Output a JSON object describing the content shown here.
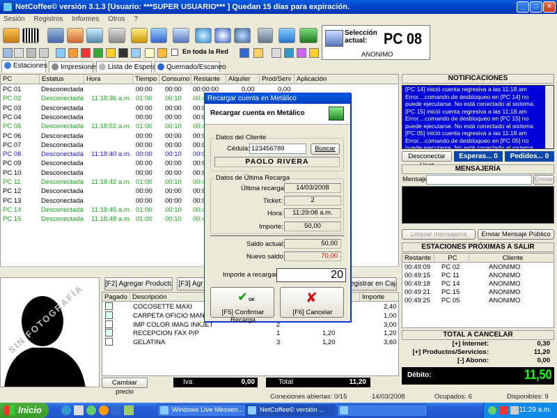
{
  "window": {
    "title": "NetCoffee© versión  3.1.3  [Usuario: ***SUPER USUARIO*** ]  Quedan 15 días para expiración."
  },
  "menu": [
    "Sesión",
    "Registros",
    "Informes",
    "Otros",
    "?"
  ],
  "toolbar": {
    "en_toda_la_red": "En toda la Red"
  },
  "selection": {
    "label_line1": "Selección",
    "label_line2": "actual:",
    "pc": "PC 08",
    "user": "ANONIMO"
  },
  "tabs": [
    "Estaciones",
    "Impresiones",
    "Lista de Espera",
    "Quemado/Escaneo"
  ],
  "stations": {
    "columns": [
      "PC",
      "Estatus",
      "Hora",
      "Tiempo",
      "Consumo",
      "Restante",
      "Alquiler",
      "Prod/Serv",
      "Aplicación"
    ],
    "rows": [
      {
        "pc": "PC 01",
        "status": "Desconectada",
        "hora": "",
        "tiempo": "00:00",
        "consumo": "00:00",
        "restante": "00:00:00",
        "alquiler": "0,00",
        "prod": "0,00",
        "color": "black"
      },
      {
        "pc": "PC 02",
        "status": "Desconectada",
        "hora": "11:18:36 a.m.",
        "tiempo": "01:00",
        "consumo": "00:10",
        "restante": "00:4",
        "alquiler": "",
        "prod": "",
        "color": "green"
      },
      {
        "pc": "PC 03",
        "status": "Desconectada",
        "hora": "",
        "tiempo": "00:00",
        "consumo": "00:00",
        "restante": "00:0",
        "alquiler": "",
        "prod": "",
        "color": "black"
      },
      {
        "pc": "PC 04",
        "status": "Desconectada",
        "hora": "",
        "tiempo": "00:00",
        "consumo": "00:00",
        "restante": "00:0",
        "alquiler": "",
        "prod": "",
        "color": "black"
      },
      {
        "pc": "PC 05",
        "status": "Desconectada",
        "hora": "11:18:52 a.m.",
        "tiempo": "01:00",
        "consumo": "00:10",
        "restante": "00:4",
        "alquiler": "",
        "prod": "",
        "color": "green"
      },
      {
        "pc": "PC 06",
        "status": "Desconectada",
        "hora": "",
        "tiempo": "00:00",
        "consumo": "00:00",
        "restante": "00:0",
        "alquiler": "",
        "prod": "",
        "color": "black"
      },
      {
        "pc": "PC 07",
        "status": "Desconectada",
        "hora": "",
        "tiempo": "00:00",
        "consumo": "00:00",
        "restante": "00:0",
        "alquiler": "",
        "prod": "",
        "color": "black"
      },
      {
        "pc": "PC 08",
        "status": "Desconectada",
        "hora": "11:18:40 a.m.",
        "tiempo": "00:00",
        "consumo": "00:10",
        "restante": "00:0",
        "alquiler": "",
        "prod": "",
        "color": "blue"
      },
      {
        "pc": "PC 09",
        "status": "Desconectada",
        "hora": "",
        "tiempo": "00:00",
        "consumo": "00:00",
        "restante": "00:0",
        "alquiler": "",
        "prod": "",
        "color": "black"
      },
      {
        "pc": "PC 10",
        "status": "Desconectada",
        "hora": "",
        "tiempo": "00:00",
        "consumo": "00:00",
        "restante": "00:0",
        "alquiler": "",
        "prod": "",
        "color": "black"
      },
      {
        "pc": "PC 11",
        "status": "Desconectada",
        "hora": "11:18:42 a.m.",
        "tiempo": "01:00",
        "consumo": "00:10",
        "restante": "00:4",
        "alquiler": "",
        "prod": "",
        "color": "green"
      },
      {
        "pc": "PC 12",
        "status": "Desconectada",
        "hora": "",
        "tiempo": "00:00",
        "consumo": "00:00",
        "restante": "00:0",
        "alquiler": "",
        "prod": "",
        "color": "black"
      },
      {
        "pc": "PC 13",
        "status": "Desconectada",
        "hora": "",
        "tiempo": "00:00",
        "consumo": "00:00",
        "restante": "00:0",
        "alquiler": "",
        "prod": "",
        "color": "black"
      },
      {
        "pc": "PC 14",
        "status": "Desconectada",
        "hora": "11:18:45 a.m.",
        "tiempo": "01:00",
        "consumo": "00:10",
        "restante": "00:4",
        "alquiler": "",
        "prod": "",
        "color": "green"
      },
      {
        "pc": "PC 15",
        "status": "Desconectada",
        "hora": "11:18:48 a.m.",
        "tiempo": "01:00",
        "consumo": "00:10",
        "restante": "00:4",
        "alquiler": "",
        "prod": "",
        "color": "green"
      }
    ]
  },
  "photo": {
    "watermark": "SIN FOTOGRAFÍA"
  },
  "products": {
    "buttons": [
      "[F2] Agregar Producto",
      "[F3] Agr",
      "egistrar en Caja"
    ],
    "columns": [
      "Pagado",
      "Descripción",
      "Importe"
    ],
    "rows": [
      {
        "desc": "COCOSETTE MAXI",
        "qty": "",
        "price": "",
        "importe": "2,40",
        "paid": "cart"
      },
      {
        "desc": "CARPETA OFICIO MANILA",
        "qty": "",
        "price": "",
        "importe": "1,00",
        "paid": "cart"
      },
      {
        "desc": "IMP COLOR IMAG INKJET",
        "qty": "2",
        "price": "",
        "importe": "3,00",
        "paid": "pencil"
      },
      {
        "desc": "RECEPCION FAX P/P",
        "qty": "1",
        "price": "1,20",
        "importe": "1,20",
        "paid": "cart"
      },
      {
        "desc": "GELATINA",
        "qty": "3",
        "price": "1,20",
        "importe": "3,60",
        "paid": "pencil"
      }
    ],
    "cambiar_precio": "Cambiar precio",
    "iva_label": "Iva",
    "iva_value": "0,00",
    "total_label": "Total",
    "total_value": "11,20"
  },
  "notifications": {
    "title": "NOTIFICACIONES",
    "messages": [
      "[PC 14] inició cuenta regresiva a las 11:18 am",
      "Error....comando de desbloqueo en [PC 14] no puede ejecutarse. No está conectado al sistema.",
      "[PC 15] inició cuenta regresiva a las 11:18 am",
      "Error....comando de desbloqueo en [PC 15] no puede ejecutarse. No está conectado al sistema.",
      "[PC 05] inició cuenta regresiva a las 11:18 am",
      "Error....comando de desbloqueo en [PC 05] no puede ejecutarse. No está conectado al sistema."
    ],
    "disconnect": "Desconectar Host",
    "esperas": "Esperas... 0",
    "pedidos": "Pedidos... 0"
  },
  "messaging": {
    "title": "MENSAJERÍA",
    "message_label": "Mensaje:",
    "send": "Enviar",
    "clear": "Limpiar mensajería",
    "send_public": "Enviar Mensaje Público"
  },
  "next_stations": {
    "title": "ESTACIONES PRÓXIMAS A SALIR",
    "columns": [
      "Restante",
      "PC",
      "Cliente"
    ],
    "rows": [
      {
        "rest": "00:49:09",
        "pc": "PC 02",
        "client": "ANONIMO"
      },
      {
        "rest": "00:49:15",
        "pc": "PC 11",
        "client": "ANONIMO"
      },
      {
        "rest": "00:49:18",
        "pc": "PC 14",
        "client": "ANONIMO"
      },
      {
        "rest": "00:49:21",
        "pc": "PC 15",
        "client": "ANONIMO"
      },
      {
        "rest": "00:49:25",
        "pc": "PC 05",
        "client": "ANONIMO"
      }
    ]
  },
  "totals": {
    "title": "TOTAL A CANCELAR",
    "internet_label": "[+] Internet:",
    "internet": "0,30",
    "prod_label": "[+] Productos/Servicios:",
    "prod": "11,20",
    "abono_label": "[-] Abono:",
    "abono": "0,00",
    "debito_label": "Débito:",
    "debito": "11,50"
  },
  "dialog": {
    "title": "Recargar cuenta en Metálico",
    "header": "Recargar cuenta en Metálico",
    "client_group": "Datos del Cliente",
    "cedula_label": "Cédula:",
    "cedula": "123456789",
    "buscar": "Buscar",
    "client_name": "PAOLO RIVERA",
    "last_group": "Datos de Última Recarga",
    "ultima_label": "Última recarga:",
    "ultima": "14/03/2008",
    "ticket_label": "Ticket:",
    "ticket": "2",
    "hora_label": "Hora:",
    "hora": "11:29:08 a.m.",
    "importe_label": "Importe:",
    "importe": "50,00",
    "saldo_label": "Saldo actual:",
    "saldo": "50,00",
    "nuevo_label": "Nuevo saldo:",
    "nuevo": "70,00",
    "recargar_label": "Importe a recargar:",
    "recargar": "20",
    "confirm": "[F5] Confirmar Recarga",
    "ok_tag": "OK",
    "cancel": "[F6] Cancelar"
  },
  "statusbar": {
    "conexiones": "Conexiones abiertas: 0/15",
    "fecha": "14/03/2008",
    "ocupados": "Ocupados: 6",
    "disponibles": "Disponibles: 9"
  },
  "taskbar": {
    "start": "Inicio",
    "tasks": [
      "Windows Live Messen...",
      "NetCoffee© versión ...",
      ""
    ],
    "clock": "11:29 a.m."
  },
  "colors": {
    "titlebar": "#0041c4",
    "notif_bg": "#0000d8",
    "debito": "#1aff1a",
    "nuevo_saldo": "#d01010",
    "active_green": "#1aa41a",
    "selected_blue": "#1a1ae0"
  }
}
